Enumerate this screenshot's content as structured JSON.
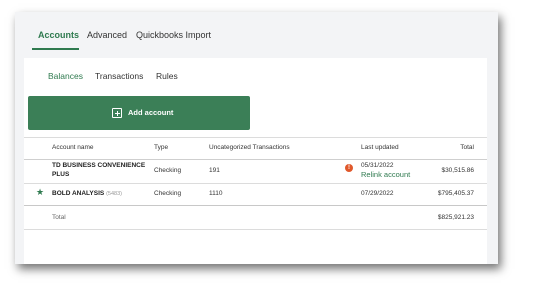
{
  "top_tabs": [
    {
      "label": "Accounts"
    },
    {
      "label": "Advanced"
    },
    {
      "label": "Quickbooks Import"
    }
  ],
  "sub_tabs": [
    {
      "label": "Balances"
    },
    {
      "label": "Transactions"
    },
    {
      "label": "Rules"
    }
  ],
  "add_account_label": "Add account",
  "table": {
    "headers": {
      "account_name": "Account name",
      "type": "Type",
      "uncategorized": "Uncategorized Transactions",
      "last_updated": "Last updated",
      "total": "Total"
    },
    "rows": [
      {
        "name_line1": "TD BUSINESS CONVENIENCE",
        "name_line2": "PLUS",
        "type": "Checking",
        "uncategorized": "191",
        "last_updated": "05/31/2022",
        "relink": "Relink account",
        "total": "$30,515.86",
        "warning_icon": "exclamation-circle-icon"
      },
      {
        "name": "BOLD ANALYSIS",
        "account_number": "(5483)",
        "type": "Checking",
        "uncategorized": "1110",
        "last_updated": "07/29/2022",
        "total": "$795,405.37",
        "favorite_icon": "star-icon"
      }
    ],
    "footer": {
      "label": "Total",
      "total": "$825,921.23"
    }
  },
  "colors": {
    "accent": "#2f7a4f",
    "button": "#3b7f57",
    "warning": "#e0582b",
    "background": "#f3f4f6"
  }
}
